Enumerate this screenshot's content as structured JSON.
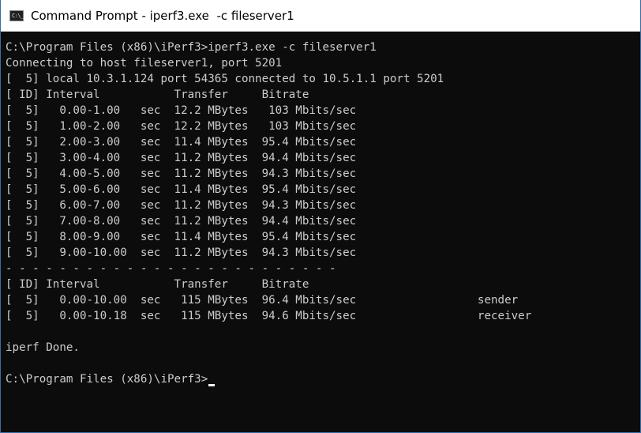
{
  "window": {
    "title": "Command Prompt - iperf3.exe  -c fileserver1",
    "icon": "cmd-icon",
    "icon_glyph": "C:\\_"
  },
  "colors": {
    "background": "#0c0c0c",
    "text": "#cccccc",
    "titlebar": "#ffffff",
    "border": "#3a6ea5"
  },
  "console": {
    "lines": [
      "C:\\Program Files (x86)\\iPerf3>iperf3.exe -c fileserver1",
      "Connecting to host fileserver1, port 5201",
      "[  5] local 10.3.1.124 port 54365 connected to 10.5.1.1 port 5201",
      "[ ID] Interval           Transfer     Bitrate",
      "[  5]   0.00-1.00   sec  12.2 MBytes   103 Mbits/sec",
      "[  5]   1.00-2.00   sec  12.2 MBytes   103 Mbits/sec",
      "[  5]   2.00-3.00   sec  11.4 MBytes  95.4 Mbits/sec",
      "[  5]   3.00-4.00   sec  11.2 MBytes  94.4 Mbits/sec",
      "[  5]   4.00-5.00   sec  11.2 MBytes  94.3 Mbits/sec",
      "[  5]   5.00-6.00   sec  11.4 MBytes  95.4 Mbits/sec",
      "[  5]   6.00-7.00   sec  11.2 MBytes  94.3 Mbits/sec",
      "[  5]   7.00-8.00   sec  11.2 MBytes  94.4 Mbits/sec",
      "[  5]   8.00-9.00   sec  11.4 MBytes  95.4 Mbits/sec",
      "[  5]   9.00-10.00  sec  11.2 MBytes  94.3 Mbits/sec",
      "- - - - - - - - - - - - - - - - - - - - - - - - -",
      "[ ID] Interval           Transfer     Bitrate",
      "[  5]   0.00-10.00  sec   115 MBytes  96.4 Mbits/sec                  sender",
      "[  5]   0.00-10.18  sec   115 MBytes  94.6 Mbits/sec                  receiver",
      "",
      "iperf Done.",
      ""
    ],
    "prompt": "C:\\Program Files (x86)\\iPerf3>"
  }
}
